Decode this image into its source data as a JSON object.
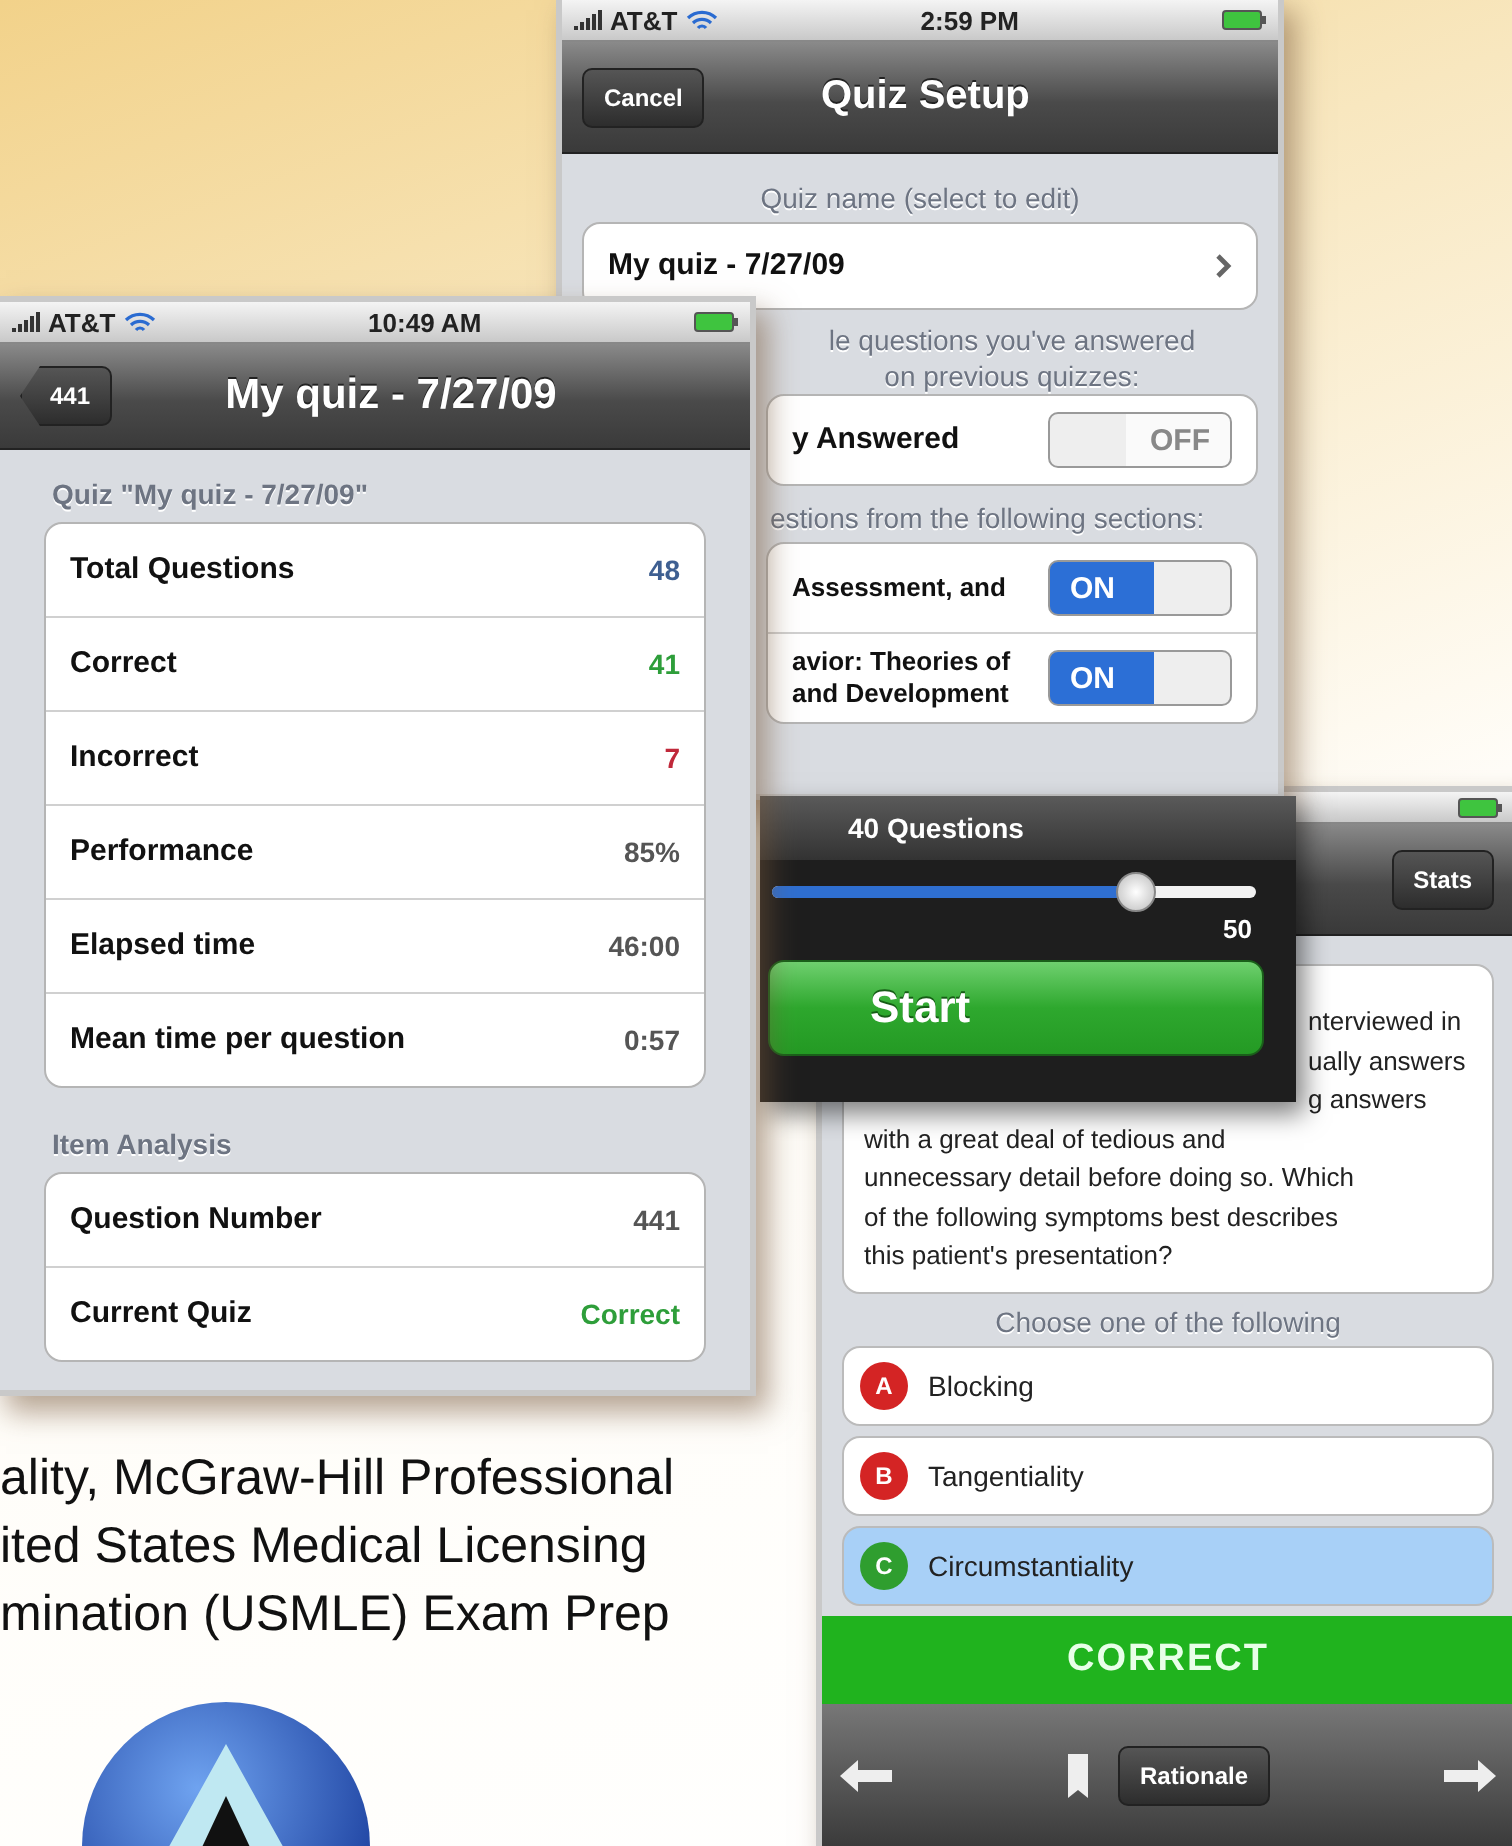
{
  "quiz_setup": {
    "status_bar": {
      "carrier": "AT&T",
      "time": "2:59 PM"
    },
    "nav": {
      "cancel": "Cancel",
      "title": "Quiz Setup"
    },
    "name_header": "Quiz name (select to edit)",
    "name_row": "My quiz - 7/27/09",
    "exclude_header": [
      "le questions you've answered",
      "on previous quizzes:"
    ],
    "answered_row": {
      "label": "y Answered",
      "switch": {
        "on": false,
        "label": "OFF"
      }
    },
    "sections_header": "estions from the following sections:",
    "sections": [
      {
        "lines": [
          "Assessment, and"
        ],
        "switch": {
          "on": true,
          "label": "ON"
        }
      },
      {
        "lines": [
          "avior: Theories of",
          "and Development"
        ],
        "switch": {
          "on": true,
          "label": "ON"
        }
      }
    ],
    "count_panel": {
      "title": "40 Questions",
      "level": 0.75,
      "max_label": "50",
      "start": "Start"
    }
  },
  "quiz_results": {
    "status_bar": {
      "carrier": "AT&T",
      "time": "10:49 AM"
    },
    "nav": {
      "back": "441",
      "title": "My quiz - 7/27/09"
    },
    "groups": [
      {
        "header": "Quiz \"My quiz - 7/27/09\"",
        "rows": [
          {
            "label": "Total Questions",
            "value": "48",
            "color": "#3e5f91"
          },
          {
            "label": "Correct",
            "value": "41",
            "color": "#2e9e3a"
          },
          {
            "label": "Incorrect",
            "value": "7",
            "color": "#c0283a"
          },
          {
            "label": "Performance",
            "value": "85%",
            "color": "#555555"
          },
          {
            "label": "Elapsed time",
            "value": "46:00",
            "color": "#555555"
          },
          {
            "label": "Mean time per question",
            "value": "0:57",
            "color": "#555555"
          }
        ]
      },
      {
        "header": "Item Analysis",
        "rows": [
          {
            "label": "Question Number",
            "value": "441",
            "color": "#555555"
          },
          {
            "label": "Current Quiz",
            "value": "Correct",
            "color": "#2e9e3a"
          }
        ]
      }
    ]
  },
  "question": {
    "nav": {
      "stats": "Stats"
    },
    "covered_lines": [
      "nterviewed in",
      "ually answers",
      "g answers"
    ],
    "lines": [
      "with a great deal of tedious and",
      "unnecessary detail before doing so. Which",
      "of the following symptoms best describes",
      "this patient's presentation?"
    ],
    "choose_header": "Choose one of the following",
    "options": [
      {
        "letter": "A",
        "label": "Blocking",
        "color": "#d42424",
        "selected": false
      },
      {
        "letter": "B",
        "label": "Tangentiality",
        "color": "#d42424",
        "selected": false
      },
      {
        "letter": "C",
        "label": "Circumstantiality",
        "color": "#2f9e2f",
        "selected": true
      }
    ],
    "result": "CORRECT",
    "toolbar": {
      "rationale": "Rationale"
    }
  },
  "caption": {
    "lines": [
      "ality, McGraw-Hill Professional",
      "ited States Medical Licensing",
      "mination (USMLE) Exam Prep"
    ]
  }
}
